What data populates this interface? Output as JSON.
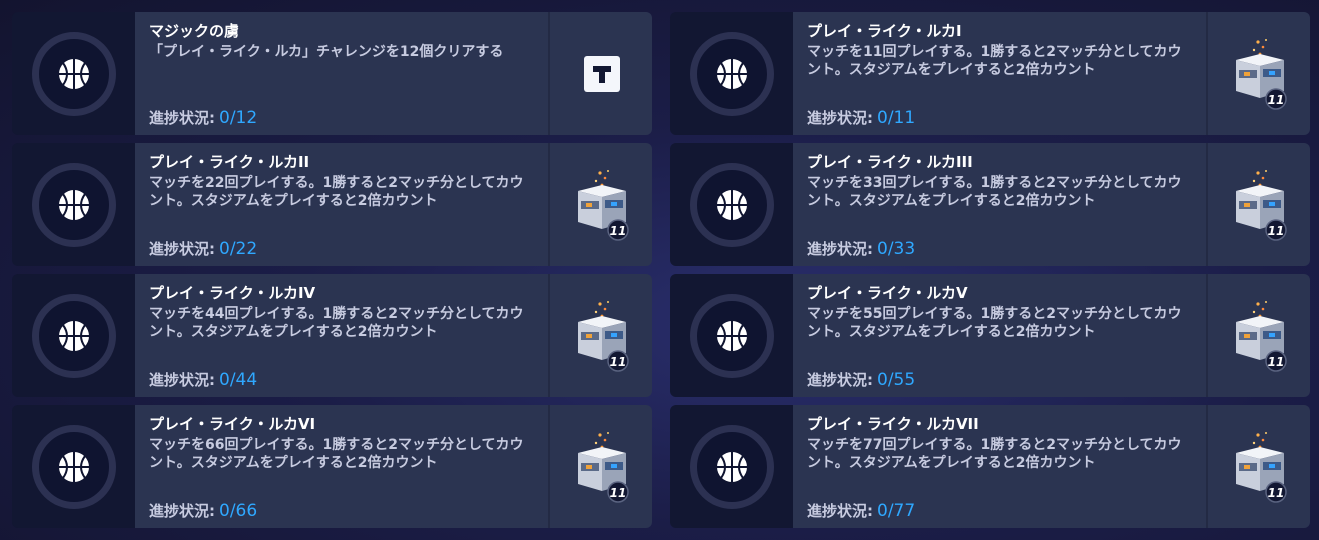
{
  "progress_label": "進捗状況:",
  "challenges": [
    {
      "title": "マジックの虜",
      "description": "「プレイ・ライク・ルカ」チャレンジを12個クリアする",
      "current": "0",
      "total": "/12",
      "reward_icon": "t-logo-icon"
    },
    {
      "title": "プレイ・ライク・ルカI",
      "description": "マッチを11回プレイする。1勝すると2マッチ分としてカウント。スタジアムをプレイすると2倍カウント",
      "current": "0",
      "total": "/11",
      "reward_icon": "loot-box-icon"
    },
    {
      "title": "プレイ・ライク・ルカII",
      "description": "マッチを22回プレイする。1勝すると2マッチ分としてカウント。スタジアムをプレイすると2倍カウント",
      "current": "0",
      "total": "/22",
      "reward_icon": "loot-box-icon"
    },
    {
      "title": "プレイ・ライク・ルカIII",
      "description": "マッチを33回プレイする。1勝すると2マッチ分としてカウント。スタジアムをプレイすると2倍カウント",
      "current": "0",
      "total": "/33",
      "reward_icon": "loot-box-icon"
    },
    {
      "title": "プレイ・ライク・ルカIV",
      "description": "マッチを44回プレイする。1勝すると2マッチ分としてカウント。スタジアムをプレイすると2倍カウント",
      "current": "0",
      "total": "/44",
      "reward_icon": "loot-box-icon"
    },
    {
      "title": "プレイ・ライク・ルカV",
      "description": "マッチを55回プレイする。1勝すると2マッチ分としてカウント。スタジアムをプレイすると2倍カウント",
      "current": "0",
      "total": "/55",
      "reward_icon": "loot-box-icon"
    },
    {
      "title": "プレイ・ライク・ルカVI",
      "description": "マッチを66回プレイする。1勝すると2マッチ分としてカウント。スタジアムをプレイすると2倍カウント",
      "current": "0",
      "total": "/66",
      "reward_icon": "loot-box-icon"
    },
    {
      "title": "プレイ・ライク・ルカVII",
      "description": "マッチを77回プレイする。1勝すると2マッチ分としてカウント。スタジアムをプレイすると2倍カウント",
      "current": "0",
      "total": "/77",
      "reward_icon": "loot-box-icon"
    }
  ],
  "loot_box_badge": "11",
  "colors": {
    "accent": "#2fa8ff",
    "card_bg": "#2b3451",
    "icon_bg": "#121732"
  }
}
